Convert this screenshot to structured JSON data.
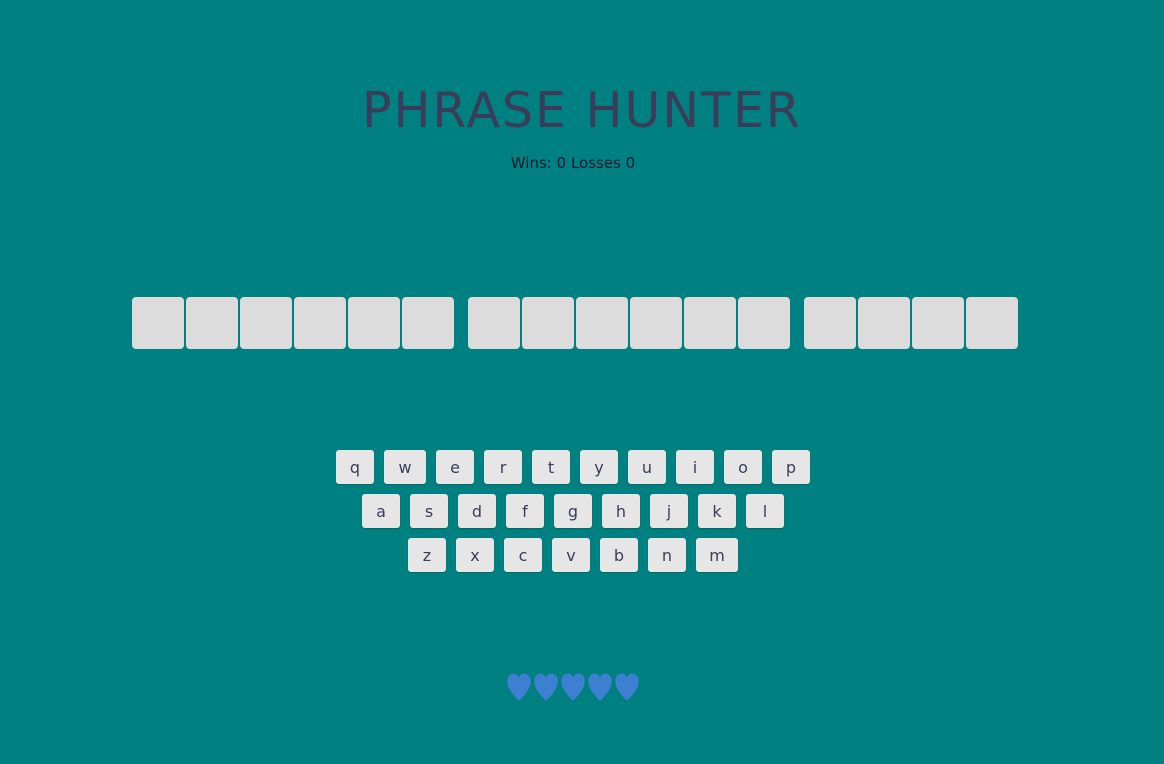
{
  "title": "PHRASE HUNTER",
  "score": {
    "wins_label": "Wins:",
    "wins": "0",
    "losses_label": "Losses",
    "losses": "0"
  },
  "phrase": {
    "words": [
      6,
      6,
      4
    ]
  },
  "keyboard": {
    "rows": [
      [
        "q",
        "w",
        "e",
        "r",
        "t",
        "y",
        "u",
        "i",
        "o",
        "p"
      ],
      [
        "a",
        "s",
        "d",
        "f",
        "g",
        "h",
        "j",
        "k",
        "l"
      ],
      [
        "z",
        "x",
        "c",
        "v",
        "b",
        "n",
        "m"
      ]
    ]
  },
  "lives": {
    "remaining": 5,
    "icon": "heart-icon",
    "color": "#3d7fd1"
  },
  "colors": {
    "background": "#018082",
    "title": "#3a3d5a",
    "tile": "#dcdcdc",
    "key": "#e6e6e6"
  }
}
